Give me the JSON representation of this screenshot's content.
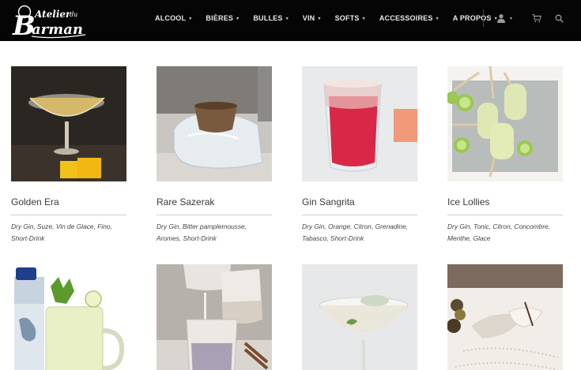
{
  "header": {
    "logo": {
      "line1": "Atelier du",
      "line2": "Barman"
    },
    "nav": [
      {
        "label": "ALCOOL",
        "name": "nav-alcool"
      },
      {
        "label": "BIÈRES",
        "name": "nav-bieres"
      },
      {
        "label": "BULLES",
        "name": "nav-bulles"
      },
      {
        "label": "VIN",
        "name": "nav-vin"
      },
      {
        "label": "SOFTS",
        "name": "nav-softs"
      },
      {
        "label": "ACCESSOIRES",
        "name": "nav-accessoires"
      },
      {
        "label": "A PROPOS",
        "name": "nav-a-propos"
      }
    ],
    "caret": "▾",
    "icons": {
      "user": "user-icon",
      "cart": "cart-icon",
      "search": "search-icon"
    }
  },
  "colors": {
    "header_bg": "#050505",
    "nav_text": "#e9e9e9",
    "divider": "#cfcfcf",
    "text": "#3a3a3a"
  },
  "cocktails": [
    {
      "title": "Golden Era",
      "ingredients": "Dry Gin, Suze, Vin de Glace, Fino, Short-Drink"
    },
    {
      "title": "Rare Sazerak",
      "ingredients": "Dry Gin, Bitter pamplemousse, Aromes, Short-Drink"
    },
    {
      "title": "Gin Sangrita",
      "ingredients": "Dry Gin, Orange, Citron, Grenadine, Tabasco, Short-Drink"
    },
    {
      "title": "Ice Lollies",
      "ingredients": "Dry Gin, Tonic, Citron, Concombre, Menthe, Glace"
    },
    {
      "title": "",
      "ingredients": ""
    },
    {
      "title": "",
      "ingredients": ""
    },
    {
      "title": "",
      "ingredients": ""
    },
    {
      "title": "",
      "ingredients": ""
    }
  ]
}
